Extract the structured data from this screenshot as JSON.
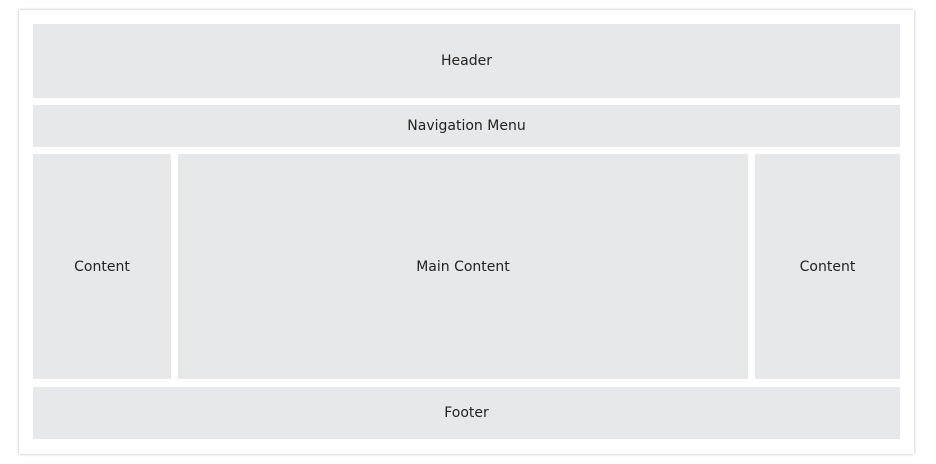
{
  "layout": {
    "header": {
      "label": "Header"
    },
    "navigation": {
      "label": "Navigation Menu"
    },
    "left_sidebar": {
      "label": "Content"
    },
    "main": {
      "label": "Main Content"
    },
    "right_sidebar": {
      "label": "Content"
    },
    "footer": {
      "label": "Footer"
    }
  },
  "colors": {
    "box_fill": "#e7e8e9",
    "background": "#ffffff",
    "text": "#222222"
  }
}
